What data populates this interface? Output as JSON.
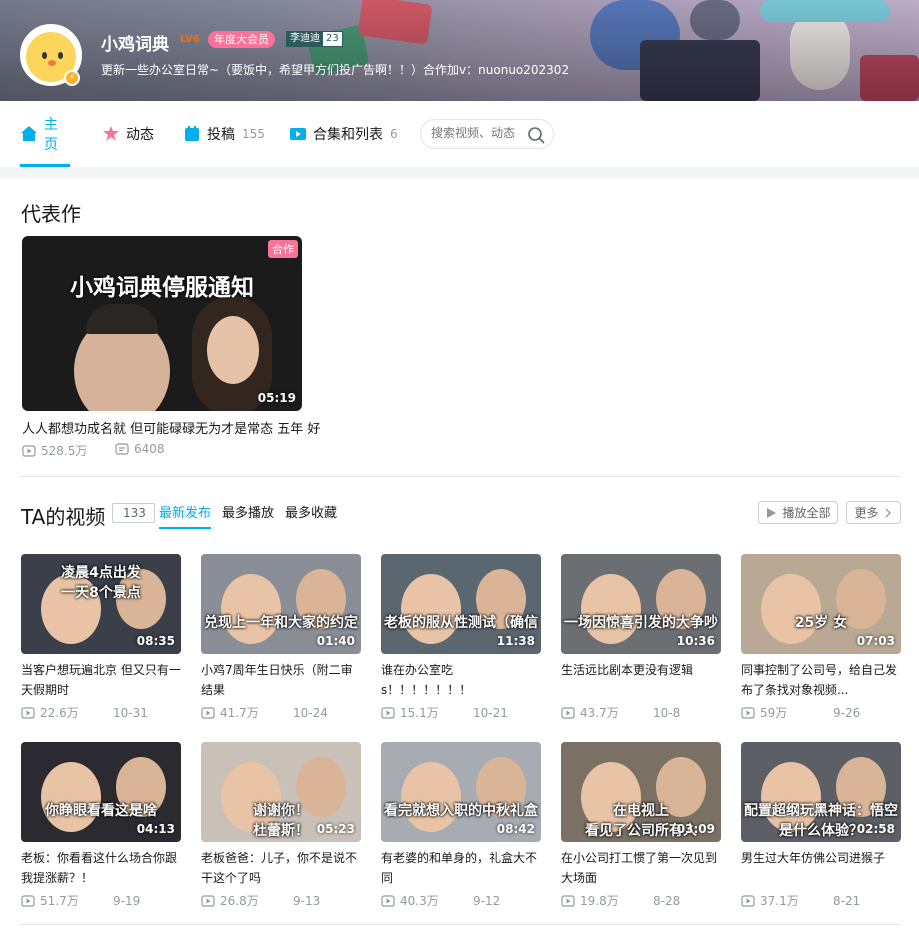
{
  "profile": {
    "name": "小鸡词典",
    "level": "LV6",
    "vip": "年度大会员",
    "medal_name": "李迪迪",
    "medal_level": "23",
    "sign": "更新一些办公室日常~（要饭中，希望甲方们投广告啊！！）合作加v：nuonuo202302"
  },
  "nav": {
    "tabs": [
      {
        "label": "主页",
        "count": ""
      },
      {
        "label": "动态",
        "count": ""
      },
      {
        "label": "投稿",
        "count": "155"
      },
      {
        "label": "合集和列表",
        "count": "6"
      }
    ],
    "search_placeholder": "搜索视频、动态"
  },
  "masterpiece": {
    "section_title": "代表作",
    "tag": "合作",
    "cover_text": "小鸡词典停服通知",
    "duration": "05:19",
    "title": "人人都想功成名就 但可能碌碌无为才是常态 五年 好",
    "plays": "528.5万",
    "comments": "6408"
  },
  "videos_section": {
    "title": "TA的视频",
    "count": "133",
    "sorts": [
      "最新发布",
      "最多播放",
      "最多收藏"
    ],
    "play_all": "播放全部",
    "more": "更多"
  },
  "videos": [
    {
      "cover_text": "凌晨4点出发\n一天8个景点",
      "duration": "08:35",
      "title": "当客户想玩遍北京 但又只有一天假期时",
      "plays": "22.6万",
      "date": "10-31",
      "color": "#3a3f4a"
    },
    {
      "cover_text": "兑现上一年和大家的约定",
      "duration": "01:40",
      "title": "小鸡7周年生日快乐（附二审结果",
      "plays": "41.7万",
      "date": "10-24",
      "color": "#8a8e96"
    },
    {
      "cover_text": "老板的服从性测试（确信",
      "duration": "11:38",
      "title": "谁在办公室吃s！！！！！！！",
      "plays": "15.1万",
      "date": "10-21",
      "color": "#5a6670"
    },
    {
      "cover_text": "一场因惊喜引发的大争吵",
      "duration": "10:36",
      "title": "生活远比剧本更没有逻辑",
      "plays": "43.7万",
      "date": "10-8",
      "color": "#6b6f74"
    },
    {
      "cover_text": "25岁  女",
      "duration": "07:03",
      "title": "同事控制了公司号，给自己发布了条找对象视频...",
      "plays": "59万",
      "date": "9-26",
      "color": "#b9a894"
    },
    {
      "cover_text": "你睁眼看看这是啥",
      "duration": "04:13",
      "title": "老板：你看看这什么场合你跟我提涨薪？！",
      "plays": "51.7万",
      "date": "9-19",
      "color": "#2a2a30"
    },
    {
      "cover_text": "谢谢你！\n杜蕾斯！",
      "duration": "05:23",
      "title": "老板爸爸：儿子，你不是说不干这个了吗",
      "plays": "26.8万",
      "date": "9-13",
      "color": "#c9c1b8"
    },
    {
      "cover_text": "看完就想入职的中秋礼盒",
      "duration": "08:42",
      "title": "有老婆的和单身的，礼盒大不同",
      "plays": "40.3万",
      "date": "9-12",
      "color": "#a7acb3"
    },
    {
      "cover_text": "在电视上\n看见了公司所有人",
      "duration": "03:09",
      "title": "在小公司打工惯了第一次见到大场面",
      "plays": "19.8万",
      "date": "8-28",
      "color": "#7b7064"
    },
    {
      "cover_text": "配置超纲玩黑神话：悟空\n是什么体验？",
      "duration": "02:58",
      "title": "男生过大年仿佛公司进猴子",
      "plays": "37.1万",
      "date": "8-21",
      "color": "#5d5f66"
    }
  ],
  "colors": {
    "accent": "#00aeec",
    "pink": "#fb7299",
    "gray_text": "#9499a0"
  },
  "icons": [
    "home-icon",
    "dynamic-icon",
    "upload-icon",
    "collection-icon",
    "search-icon",
    "play-icon",
    "danmaku-icon",
    "chevron-right-icon"
  ]
}
